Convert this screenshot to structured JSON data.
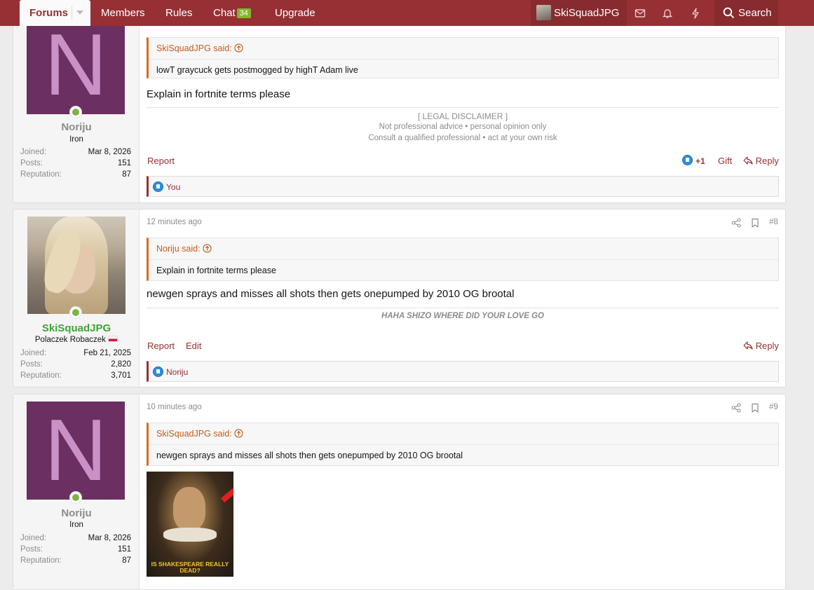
{
  "navbar": {
    "forums_label": "Forums",
    "members_label": "Members",
    "rules_label": "Rules",
    "chat_label": "Chat",
    "chat_count": "34",
    "upgrade_label": "Upgrade",
    "username": "SkiSquadJPG",
    "search_label": "Search"
  },
  "posts": [
    {
      "user": {
        "name": "Noriju",
        "title": "Iron",
        "avatar_letter": "N",
        "joined_label": "Joined:",
        "joined": "Mar 8, 2026",
        "posts_label": "Posts:",
        "posts": "151",
        "rep_label": "Reputation:",
        "reputation": "87"
      },
      "quote_author": "SkiSquadJPG said:",
      "quote_text": "lowT graycuck gets postmogged by highT Adam live",
      "message": "Explain in fortnite terms please",
      "signature": [
        "[ LEGAL DISCLAIMER ]",
        "Not professional advice • personal opinion only",
        "Consult a qualified professional • act at your own risk"
      ],
      "actions": {
        "report": "Report",
        "reaction_count": "+1",
        "gift": "Gift",
        "reply": "Reply"
      },
      "reacted_by": "You"
    },
    {
      "time": "12 minutes ago",
      "number": "#8",
      "user": {
        "name": "SkiSquadJPG",
        "title": "Polaczek Robaczek",
        "joined_label": "Joined:",
        "joined": "Feb 21, 2025",
        "posts_label": "Posts:",
        "posts": "2,820",
        "rep_label": "Reputation:",
        "reputation": "3,701"
      },
      "quote_author": "Noriju said:",
      "quote_text": "Explain in fortnite terms please",
      "message": "newgen sprays and misses all shots then gets onepumped by 2010 OG brootal",
      "signature": "HAHA SHIZO WHERE DID YOUR LOVE GO",
      "actions": {
        "report": "Report",
        "edit": "Edit",
        "reply": "Reply"
      },
      "reacted_by": "Noriju"
    },
    {
      "time": "10 minutes ago",
      "number": "#9",
      "user": {
        "name": "Noriju",
        "title": "Iron",
        "avatar_letter": "N",
        "joined_label": "Joined:",
        "joined": "Mar 8, 2026",
        "posts_label": "Posts:",
        "posts": "151",
        "rep_label": "Reputation:",
        "reputation": "87"
      },
      "quote_author": "SkiSquadJPG said:",
      "quote_text": "newgen sprays and misses all shots then gets onepumped by 2010 OG brootal",
      "image_caption": "IS SHAKESPEARE REALLY DEAD?"
    }
  ],
  "colors": {
    "brand": "#963034",
    "quote_accent": "#d66c1f",
    "online": "#7cb342",
    "username_green": "#3fa535",
    "avatar_purple": "#6b2f62"
  }
}
